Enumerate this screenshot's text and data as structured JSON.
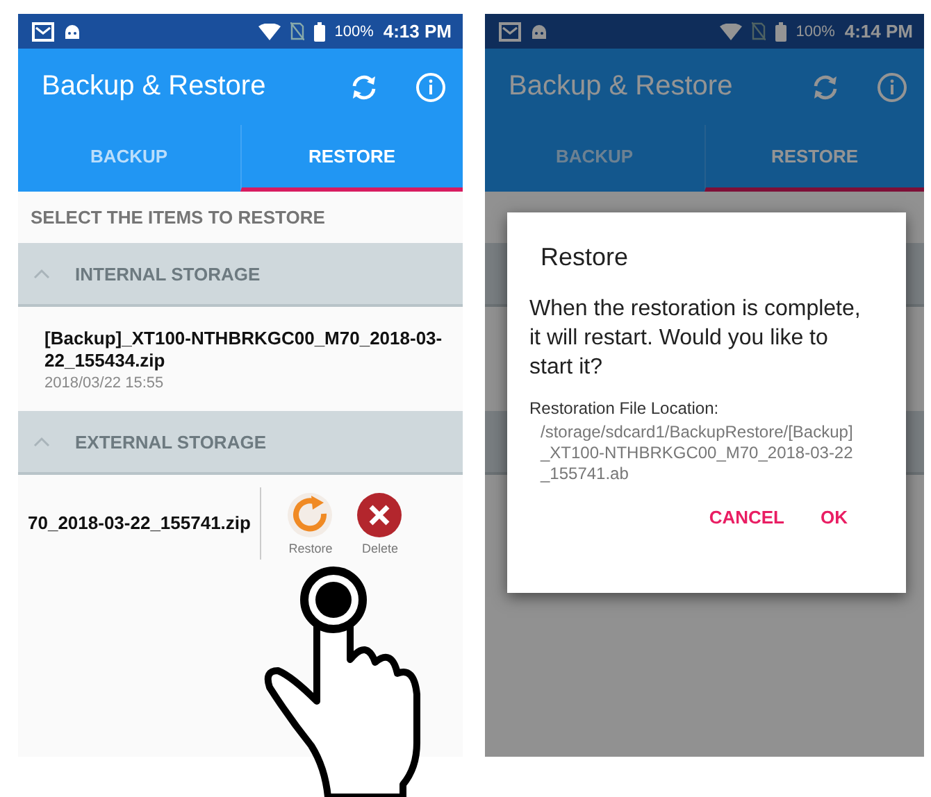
{
  "screens": [
    {
      "dimmed": false,
      "status_bar": {
        "battery": "100%",
        "time": "4:13 PM"
      },
      "app_bar": {
        "title": "Backup & Restore"
      },
      "tabs": [
        {
          "label": "BACKUP",
          "selected": false
        },
        {
          "label": "RESTORE",
          "selected": true
        }
      ],
      "section_label": "SELECT THE ITEMS TO RESTORE",
      "groups": [
        {
          "title": "INTERNAL STORAGE",
          "expanded": true,
          "files": [
            {
              "kind": "item",
              "name": "[Backup]_XT100-NTHBRKGC00_M70_2018-03-22_155434.zip",
              "date": "2018/03/22 15:55"
            }
          ]
        },
        {
          "title": "EXTERNAL STORAGE",
          "expanded": true,
          "files": [
            {
              "kind": "swiped",
              "name": "70_2018-03-22_155741.zip",
              "actions": [
                {
                  "kind": "restore",
                  "label": "Restore"
                },
                {
                  "kind": "delete",
                  "label": "Delete"
                }
              ]
            }
          ]
        }
      ]
    },
    {
      "dimmed": true,
      "status_bar": {
        "battery": "100%",
        "time": "4:14 PM"
      },
      "app_bar": {
        "title": "Backup & Restore"
      },
      "tabs": [
        {
          "label": "BACKUP",
          "selected": false
        },
        {
          "label": "RESTORE",
          "selected": true
        }
      ],
      "dialog": {
        "title": "Restore",
        "message": "When the restoration is complete, it will restart. Would you like to start it?",
        "location_label": "Restoration File Location:",
        "location": "/storage/sdcard1/BackupRestore/[Backup]_XT100-NTHBRKGC00_M70_2018-03-22_155741.ab",
        "buttons": [
          "CANCEL",
          "OK"
        ]
      }
    }
  ]
}
